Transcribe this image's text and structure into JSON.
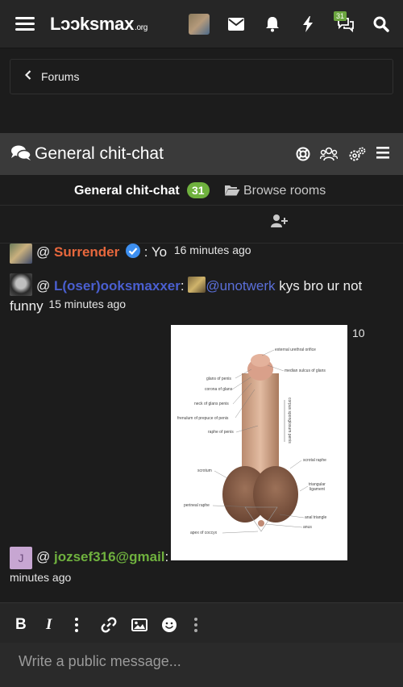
{
  "top_nav": {
    "logo_main": "Lɔɔksmax",
    "logo_tld": ".org",
    "notif_badge": "31"
  },
  "breadcrumb": {
    "label": "Forums"
  },
  "room": {
    "title": "General chit-chat",
    "tab_active": "General chit-chat",
    "tab_count": "31",
    "tab_browse": "Browse rooms"
  },
  "messages": [
    {
      "at": "@",
      "user": "Surrender",
      "text": ": Yo",
      "time": "16 minutes ago"
    },
    {
      "at": "@",
      "user": "L(oser)ooksmaxxer",
      "colon": ":",
      "mention": "@unotwerk",
      "text": " kys bro ur not",
      "text2": "funny",
      "time": "15 minutes ago"
    },
    {
      "time_partial": "10",
      "at": "@",
      "user": "jozsef316@gmail",
      "colon": ":",
      "time_rest": "minutes ago",
      "avatar_letter": "J"
    }
  ],
  "diagram_labels": {
    "l1": "external urethral orifice",
    "l2": "median sulcus of glans",
    "l3": "glans of penis",
    "l4": "corona of glans",
    "l5": "neck of glans penis",
    "l6": "frenulum of prepuce of penis",
    "l7": "raphe of penis",
    "l8": "corpus spongiosum penis",
    "l9": "scrotum",
    "l10": "scrotal raphe",
    "l11": "triangular",
    "l12": "ligament",
    "l13": "perineal raphe",
    "l14": "anal triangle",
    "l15": "anus",
    "l16": "apex of coccyx"
  },
  "composer": {
    "placeholder": "Write a public message..."
  },
  "colors": {
    "accent_green": "#6fb13e",
    "username_red": "#e8683d",
    "username_blue": "#4a5fd0",
    "background": "#1c1c1c"
  }
}
